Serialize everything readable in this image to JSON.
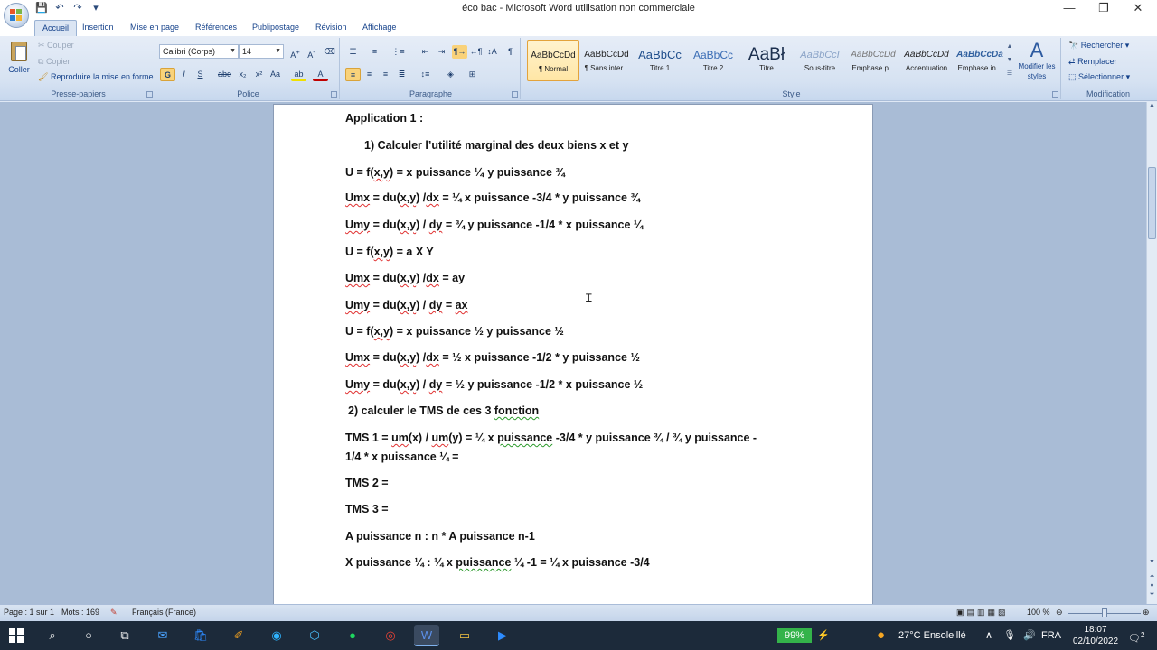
{
  "window": {
    "title": "éco bac - Microsoft Word utilisation non commerciale",
    "controls": [
      "—",
      "❐",
      "✕"
    ]
  },
  "quick_access": [
    "💾",
    "↶",
    "↷",
    "▾"
  ],
  "tabs": [
    {
      "label": "Accueil",
      "active": true
    },
    {
      "label": "Insertion"
    },
    {
      "label": "Mise en page"
    },
    {
      "label": "Références"
    },
    {
      "label": "Publipostage"
    },
    {
      "label": "Révision"
    },
    {
      "label": "Affichage"
    }
  ],
  "ribbon": {
    "clipboard": {
      "label": "Presse-papiers",
      "paste": "Coller",
      "cut": "Couper",
      "copy": "Copier",
      "format_painter": "Reproduire la mise en forme"
    },
    "font": {
      "label": "Police",
      "font_name": "Calibri (Corps)",
      "font_size": "14"
    },
    "paragraph": {
      "label": "Paragraphe"
    },
    "styles": {
      "label": "Style",
      "items": [
        {
          "sample": "AaBbCcDd",
          "name": "¶ Normal",
          "selected": true
        },
        {
          "sample": "AaBbCcDd",
          "name": "¶ Sans inter..."
        },
        {
          "sample": "AaBbCc",
          "name": "Titre 1"
        },
        {
          "sample": "AaBbCc",
          "name": "Titre 2"
        },
        {
          "sample": "AaBł",
          "name": "Titre"
        },
        {
          "sample": "AaBbCcI",
          "name": "Sous-titre"
        },
        {
          "sample": "AaBbCcDd",
          "name": "Emphase p..."
        },
        {
          "sample": "AaBbCcDd",
          "name": "Accentuation"
        },
        {
          "sample": "AaBbCcDa",
          "name": "Emphase in..."
        }
      ],
      "change_styles": "Modifier les styles"
    },
    "editing": {
      "label": "Modification",
      "find": "Rechercher",
      "replace": "Remplacer",
      "select": "Sélectionner"
    }
  },
  "document": {
    "lines": [
      "Application 1 :",
      "1)  Calculer l’utilité marginal des deux biens x et y",
      "U = f(x,y) = x puissance ¼ y puissance ¾",
      "Umx = du(x,y) /dx = ¼ x puissance -3/4 * y puissance ¾",
      "Umy = du(x,y) / dy = ¾ y puissance -1/4 * x puissance ¼",
      "U = f(x,y) = a X Y",
      "Umx = du(x,y) /dx = ay",
      "Umy = du(x,y) / dy = ax",
      "U = f(x,y) = x puissance ½ y puissance ½",
      "Umx = du(x,y) /dx = ½ x puissance -1/2 * y puissance ½",
      "Umy = du(x,y) / dy = ½ y puissance -1/2 * x puissance ½",
      "2) calculer le TMS de ces 3 fonction",
      "TMS 1 = um(x) / um(y) = ¼ x puissance -3/4 * y puissance ¾ / ¾ y puissance -",
      "1/4 * x puissance ¼ =",
      "TMS 2 =",
      "TMS 3 =",
      "A puissance  n : n * A puissance n-1",
      "X puissance ¼ : ¼ x puissance ¼ -1 = ¼ x puissance -3/4"
    ]
  },
  "status": {
    "page": "Page : 1 sur 1",
    "words": "Mots : 169",
    "language": "Français (France)",
    "zoom": "100 %"
  },
  "taskbar": {
    "battery": "99%",
    "weather": "27°C  Ensoleillé",
    "lang": "FRA",
    "time": "18:07",
    "date": "02/10/2022",
    "notifications": "2"
  }
}
